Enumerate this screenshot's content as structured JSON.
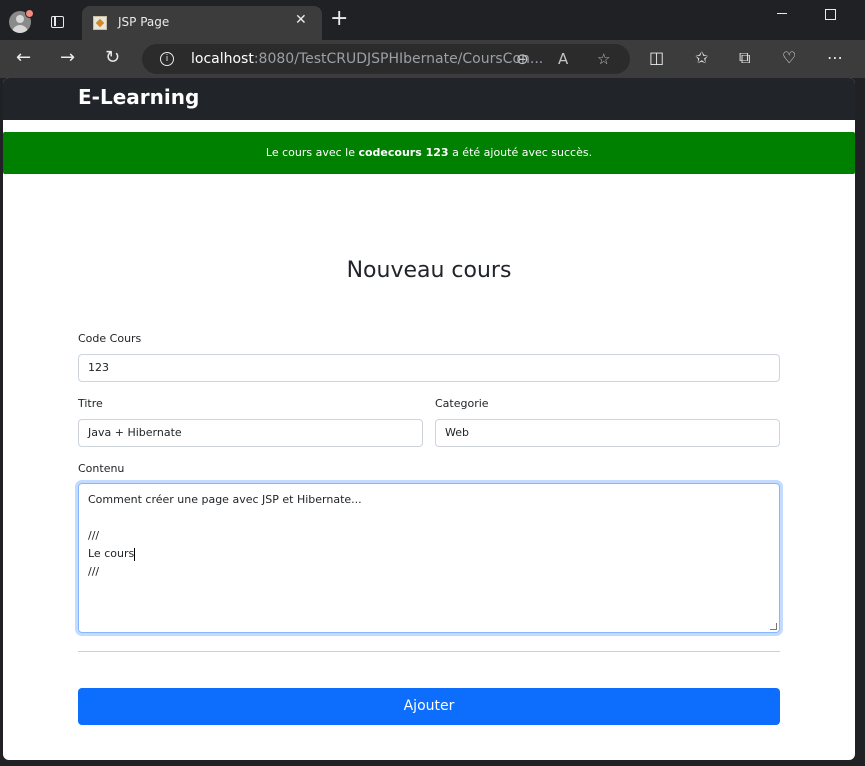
{
  "browser": {
    "tab_title": "JSP Page",
    "url_host": "localhost",
    "url_rest": ":8080/TestCRUDJSPHIbernate/CoursCon..."
  },
  "navbar": {
    "brand": "E-Learning"
  },
  "alert": {
    "prefix": "Le cours avec le ",
    "bold": "codecours 123",
    "suffix": " a été ajouté avec succès.",
    "color": "#008000"
  },
  "form": {
    "title": "Nouveau cours",
    "code_label": "Code Cours",
    "code_value": "123",
    "titre_label": "Titre",
    "titre_value": "Java + Hibernate",
    "categorie_label": "Categorie",
    "categorie_value": "Web",
    "contenu_label": "Contenu",
    "contenu_line1": "Comment créer une page avec JSP et Hibernate...",
    "contenu_line2": "",
    "contenu_line3": "///",
    "contenu_line4": "Le cours",
    "contenu_line5": "///",
    "submit_label": "Ajouter",
    "submit_color": "#0d6efd"
  }
}
